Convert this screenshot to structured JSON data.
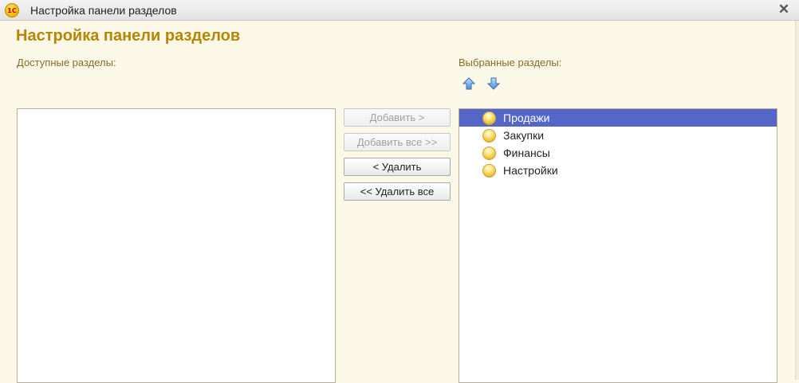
{
  "window": {
    "title": "Настройка панели разделов",
    "app_logo_text": "1С",
    "close_glyph": "✕"
  },
  "header": {
    "title": "Настройка панели разделов"
  },
  "available": {
    "label": "Доступные разделы:",
    "items": []
  },
  "selected": {
    "label": "Выбранные разделы:",
    "items": [
      {
        "label": "Продажи",
        "icon": "section-ball-icon",
        "selected": true
      },
      {
        "label": "Закупки",
        "icon": "section-ball-icon",
        "selected": false
      },
      {
        "label": "Финансы",
        "icon": "section-ball-icon",
        "selected": false
      },
      {
        "label": "Настройки",
        "icon": "section-ball-icon",
        "selected": false
      }
    ]
  },
  "buttons": {
    "add": {
      "label": "Добавить >",
      "enabled": false
    },
    "add_all": {
      "label": "Добавить все >>",
      "enabled": false
    },
    "remove": {
      "label": "< Удалить",
      "enabled": true
    },
    "remove_all": {
      "label": "<< Удалить все",
      "enabled": true
    }
  },
  "colors": {
    "accent_title": "#b88500",
    "selection": "#5466c8",
    "background": "#fbf8e8"
  }
}
